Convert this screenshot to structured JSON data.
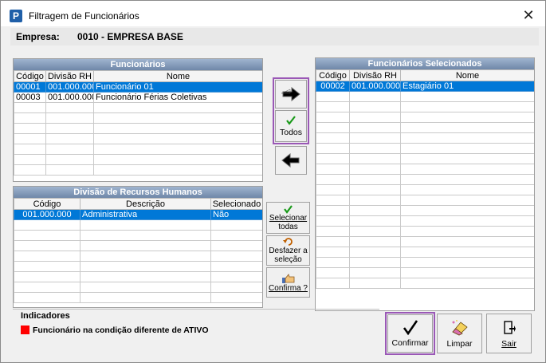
{
  "window": {
    "title": "Filtragem de Funcionários",
    "app_icon_letter": "P",
    "close_glyph": "✕"
  },
  "empresa": {
    "label": "Empresa:",
    "value": "0010 - EMPRESA BASE"
  },
  "funcionarios": {
    "title": "Funcionários",
    "columns": [
      "Código",
      "Divisão RH",
      "Nome"
    ],
    "rows": [
      {
        "codigo": "00001",
        "divisao": "001.000.000",
        "nome": "Funcionário 01",
        "selected": true
      },
      {
        "codigo": "00003",
        "divisao": "001.000.000",
        "nome": "Funcionário Férias Coletivas",
        "selected": false
      }
    ]
  },
  "divisao_rh": {
    "title": "Divisão de Recursos Humanos",
    "columns": [
      "Código",
      "Descrição",
      "Selecionado"
    ],
    "rows": [
      {
        "codigo": "001.000.000",
        "descricao": "Administrativa",
        "selecionado": "Não",
        "selected": true
      }
    ]
  },
  "selecionados": {
    "title": "Funcionários Selecionados",
    "columns": [
      "Código",
      "Divisão RH",
      "Nome"
    ],
    "rows": [
      {
        "codigo": "00002",
        "divisao": "001.000.000",
        "nome": "Estagiário 01",
        "selected": true
      }
    ]
  },
  "transfer": {
    "todos_label": "Todos",
    "icons": [
      "arrow-right-icon",
      "checkmark-icon",
      "arrow-left-icon"
    ]
  },
  "side_buttons": {
    "selecionar_line1": "Selecionar",
    "selecionar_line2": "todas",
    "desfazer_line1": "Desfazer a",
    "desfazer_line2": "seleção",
    "confirma": "Confirma ?"
  },
  "indicadores": {
    "title": "Indicadores",
    "legend_text": "Funcionário na condição diferente de ATIVO",
    "legend_color": "#ff0000"
  },
  "bottom_buttons": {
    "confirmar": "Confirmar",
    "limpar": "Limpar",
    "sair": "Sair"
  },
  "colors": {
    "selection": "#0078d7",
    "header_gradient_top": "#9fb4cf",
    "header_gradient_bottom": "#6f87a8",
    "highlight_frame": "#9a58b6"
  }
}
